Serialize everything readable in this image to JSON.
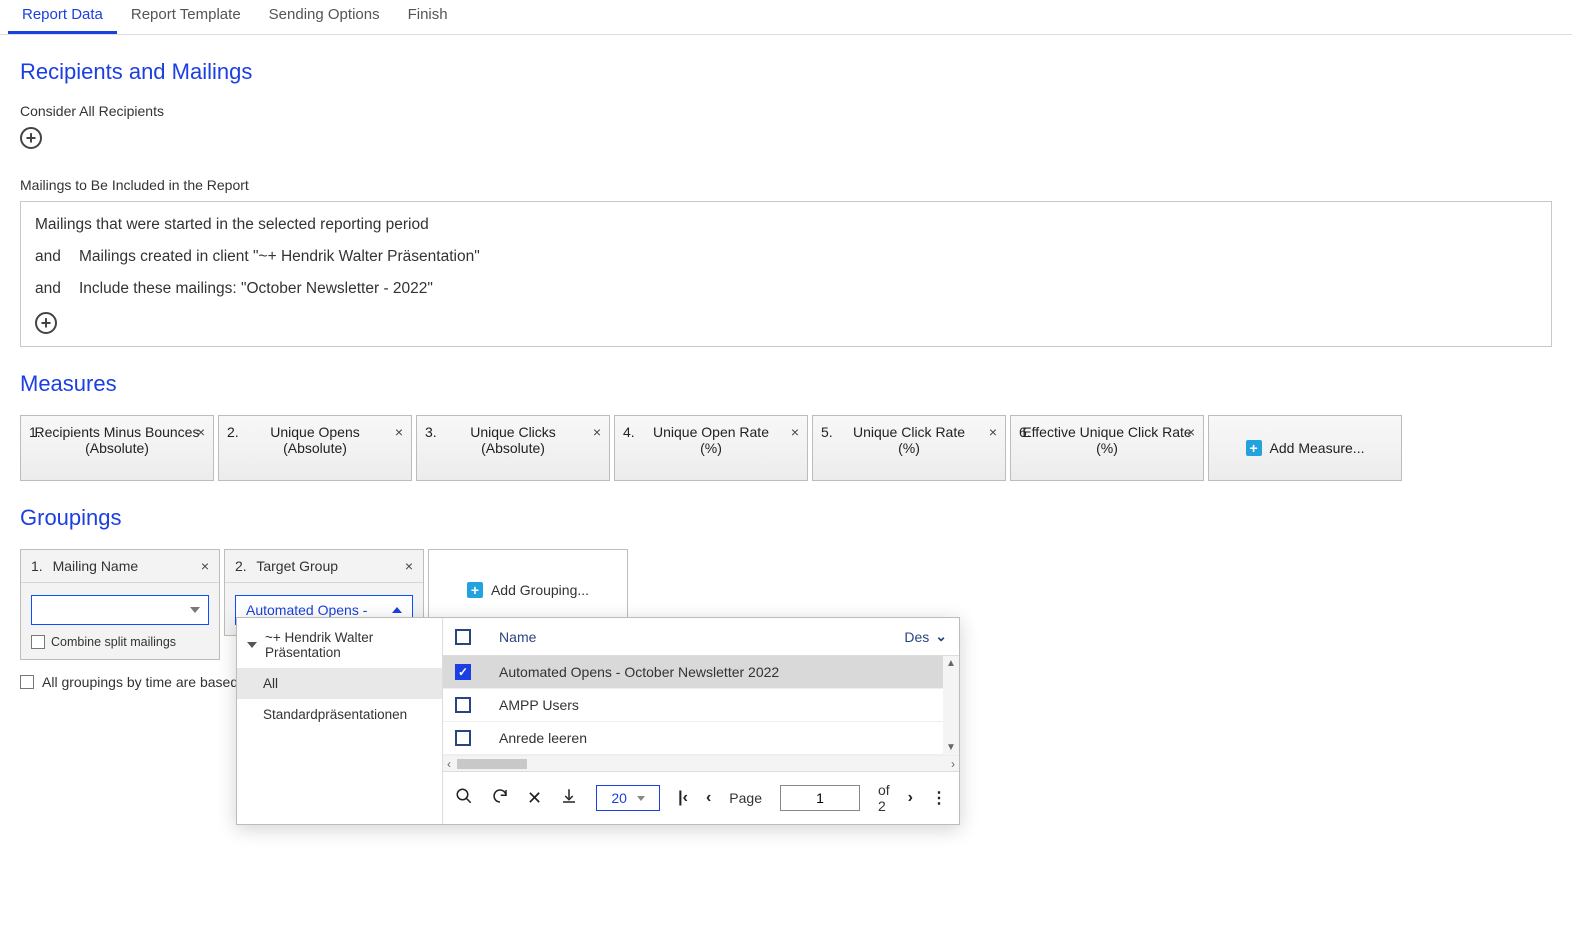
{
  "tabs": [
    "Report Data",
    "Report Template",
    "Sending Options",
    "Finish"
  ],
  "active_tab_index": 0,
  "sections": {
    "recipients_title": "Recipients and Mailings",
    "consider_label": "Consider All Recipients",
    "mailings_label": "Mailings to Be Included in the Report",
    "measures_title": "Measures",
    "groupings_title": "Groupings"
  },
  "conditions": {
    "c1": "Mailings that were started in the selected reporting period",
    "and": "and",
    "c2": "Mailings created in client \"~+ Hendrik Walter Präsentation\"",
    "c3": "Include these mailings: \"October Newsletter - 2022\""
  },
  "measures": [
    {
      "n": "1.",
      "title": "Recipients Minus Bounces",
      "unit": "(Absolute)"
    },
    {
      "n": "2.",
      "title": "Unique Opens",
      "unit": "(Absolute)"
    },
    {
      "n": "3.",
      "title": "Unique Clicks",
      "unit": "(Absolute)"
    },
    {
      "n": "4.",
      "title": "Unique Open Rate",
      "unit": "(%)"
    },
    {
      "n": "5.",
      "title": "Unique Click Rate",
      "unit": "(%)"
    },
    {
      "n": "6.",
      "title": "Effective Unique Click Rate",
      "unit": "(%)"
    }
  ],
  "add_measure": "Add Measure...",
  "groupings": {
    "g1": {
      "n": "1.",
      "label": "Mailing Name",
      "combine": "Combine split mailings"
    },
    "g2": {
      "n": "2.",
      "label": "Target Group",
      "selected": "Automated Opens -"
    },
    "add": "Add Grouping..."
  },
  "lower_check": "All groupings by time are based",
  "dropdown": {
    "tree": {
      "root": "~+ Hendrik Walter Präsentation",
      "items": [
        "All",
        "Standardpräsentationen"
      ],
      "selected_index": 0
    },
    "header": {
      "name": "Name",
      "sort": "Des"
    },
    "rows": [
      {
        "label": "Automated Opens - October Newsletter 2022",
        "checked": true
      },
      {
        "label": "AMPP Users",
        "checked": false
      },
      {
        "label": "Anrede leeren",
        "checked": false
      }
    ],
    "footer": {
      "page_size": "20",
      "page_label": "Page",
      "page_value": "1",
      "of": "of 2"
    }
  }
}
